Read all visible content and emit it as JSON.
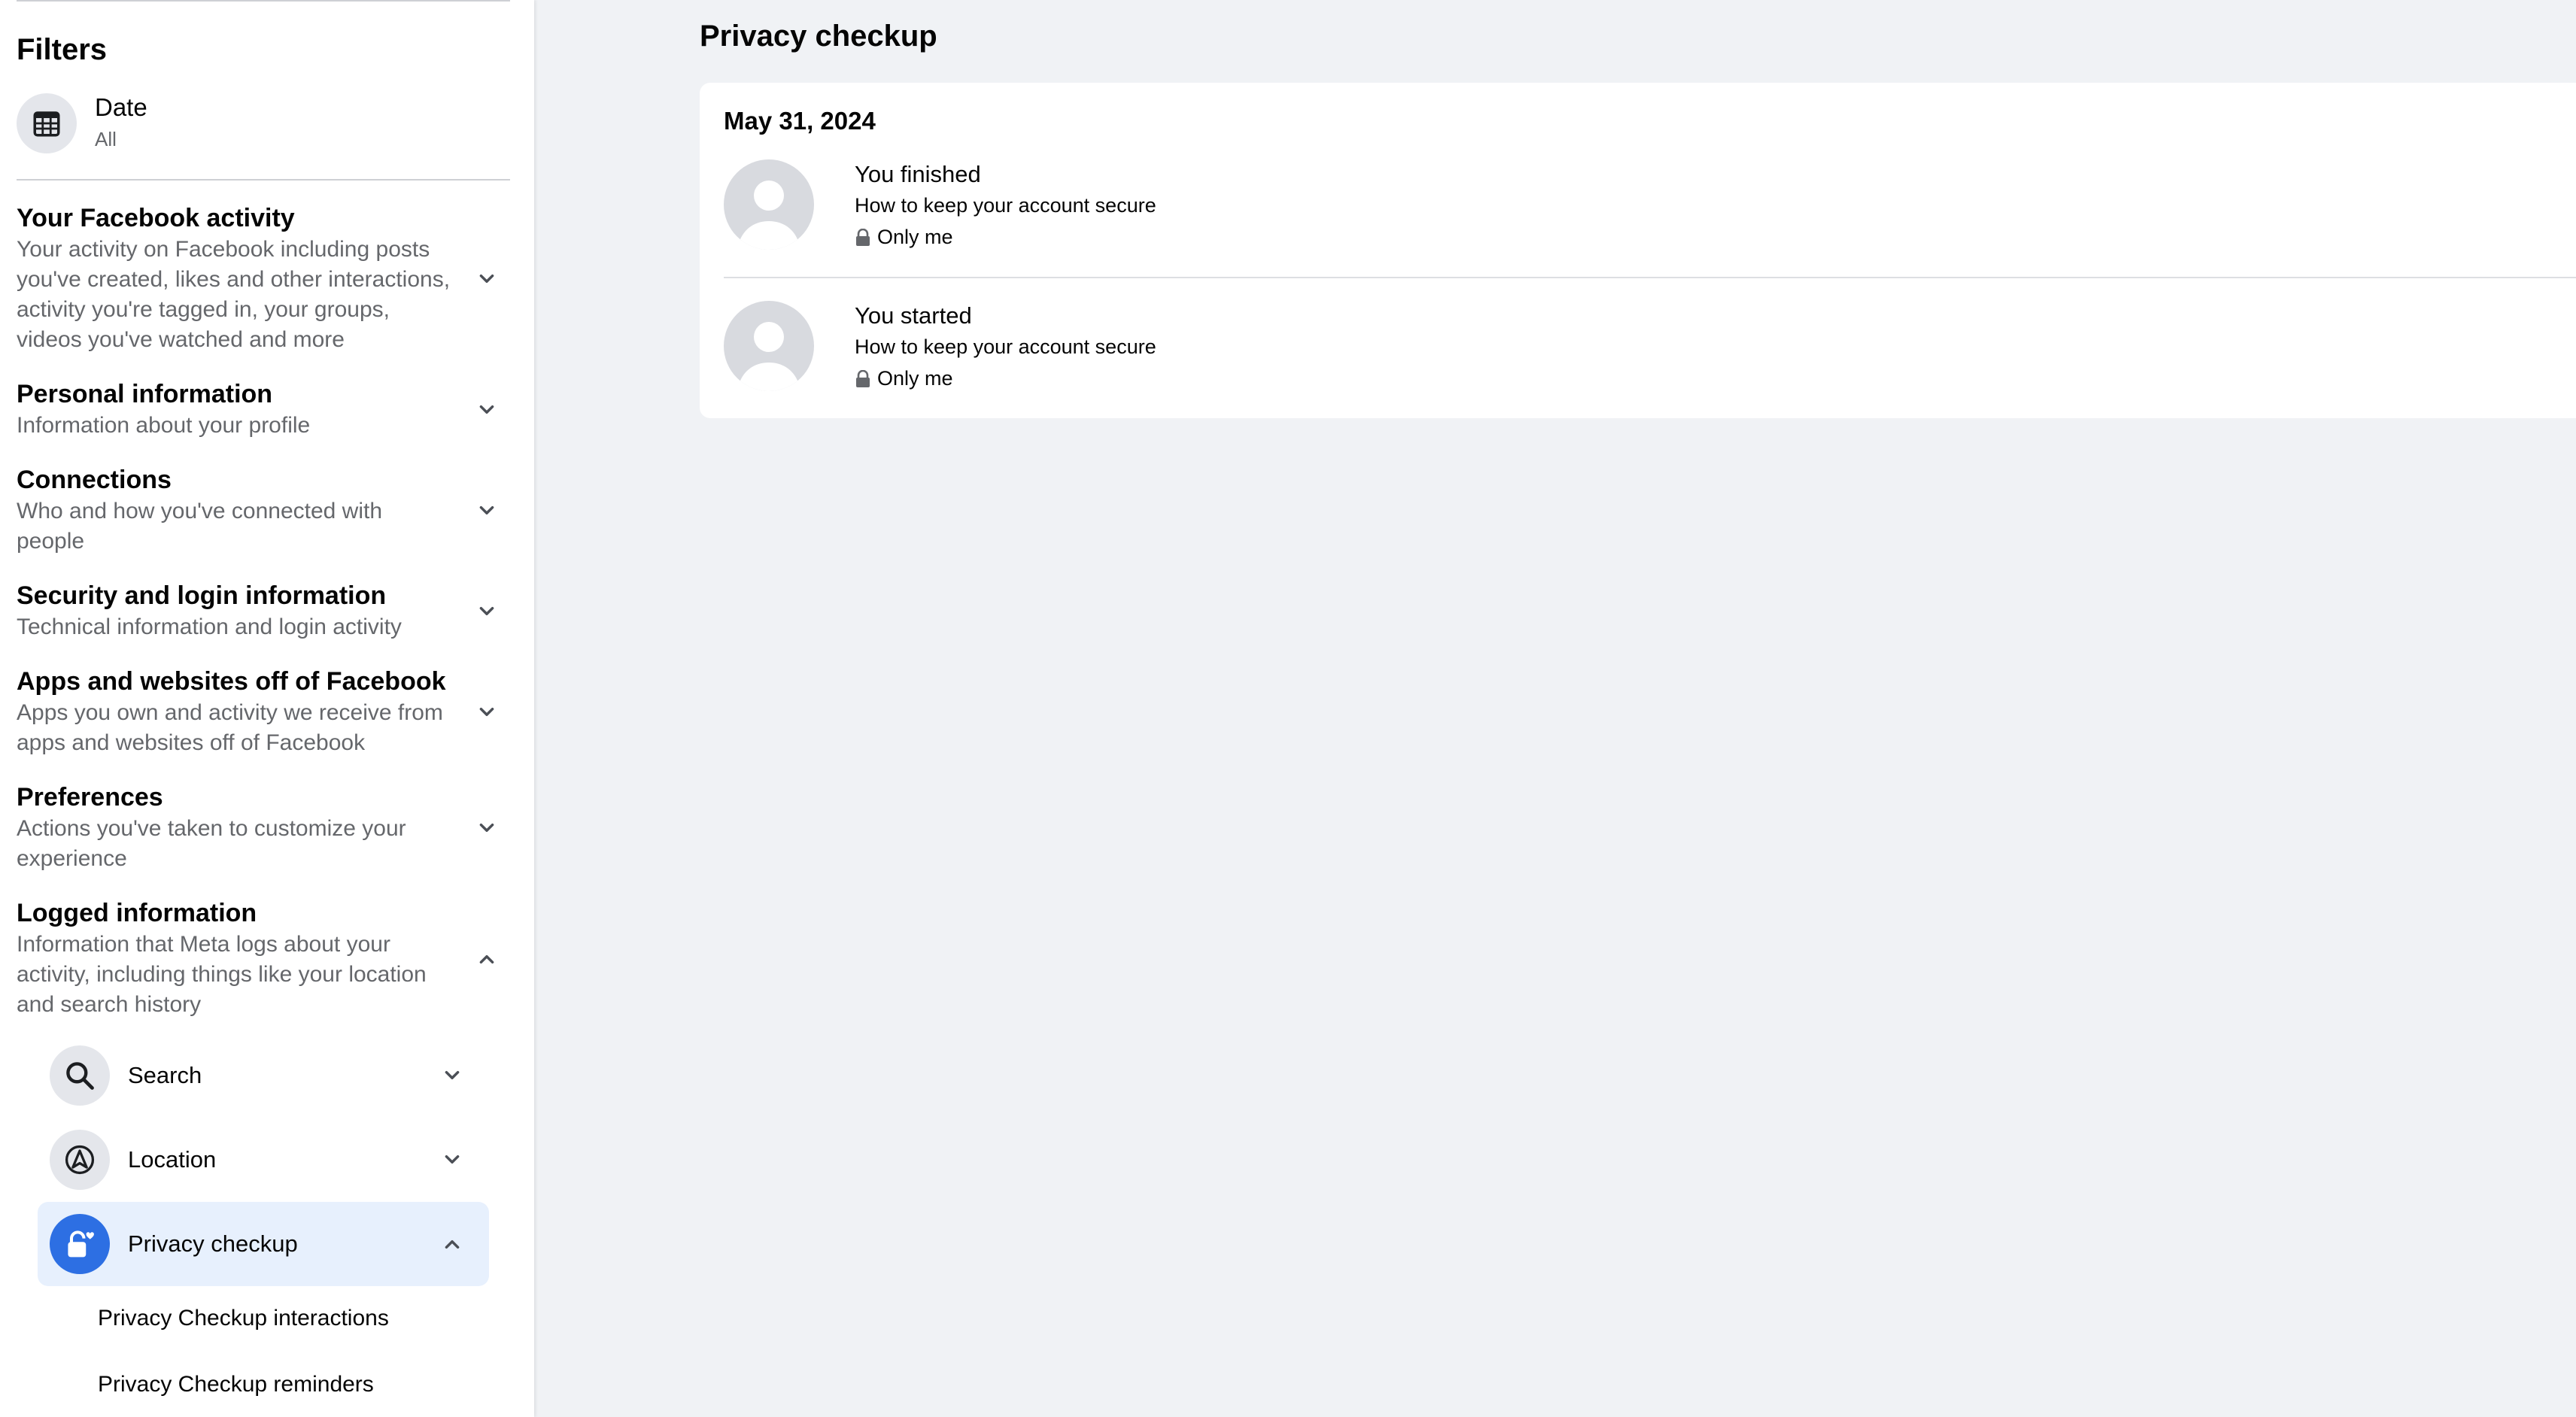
{
  "sidebar": {
    "filters_title": "Filters",
    "date_filter": {
      "label": "Date",
      "value": "All",
      "icon": "calendar-icon"
    },
    "sections": [
      {
        "title": "Your Facebook activity",
        "description": "Your activity on Facebook including posts you've created, likes and other interactions, activity you're tagged in, your groups, videos you've watched and more",
        "expanded": false
      },
      {
        "title": "Personal information",
        "description": "Information about your profile",
        "expanded": false
      },
      {
        "title": "Connections",
        "description": "Who and how you've connected with people",
        "expanded": false
      },
      {
        "title": "Security and login information",
        "description": "Technical information and login activity",
        "expanded": false
      },
      {
        "title": "Apps and websites off of Facebook",
        "description": "Apps you own and activity we receive from apps and websites off of Facebook",
        "expanded": false
      },
      {
        "title": "Preferences",
        "description": "Actions you've taken to customize your experience",
        "expanded": false
      },
      {
        "title": "Logged information",
        "description": "Information that Meta logs about your activity, including things like your location and search history",
        "expanded": true
      }
    ],
    "logged_items": [
      {
        "label": "Search",
        "icon": "search-icon",
        "expanded": false
      },
      {
        "label": "Location",
        "icon": "location-arrow-icon",
        "expanded": false
      },
      {
        "label": "Privacy checkup",
        "icon": "lock-heart-icon",
        "expanded": true,
        "active": true
      }
    ],
    "privacy_subitems": [
      "Privacy Checkup interactions",
      "Privacy Checkup reminders"
    ]
  },
  "main": {
    "title": "Privacy checkup",
    "card": {
      "date": "May 31, 2024",
      "entries": [
        {
          "title": "You finished",
          "subtitle": "How to keep your account secure",
          "audience": "Only me"
        },
        {
          "title": "You started",
          "subtitle": "How to keep your account secure",
          "audience": "Only me"
        }
      ]
    }
  },
  "colors": {
    "accent": "#2d6fe3",
    "active_bg": "#e7f0fd",
    "page_bg": "#f0f2f5",
    "secondary_text": "#65676b"
  }
}
